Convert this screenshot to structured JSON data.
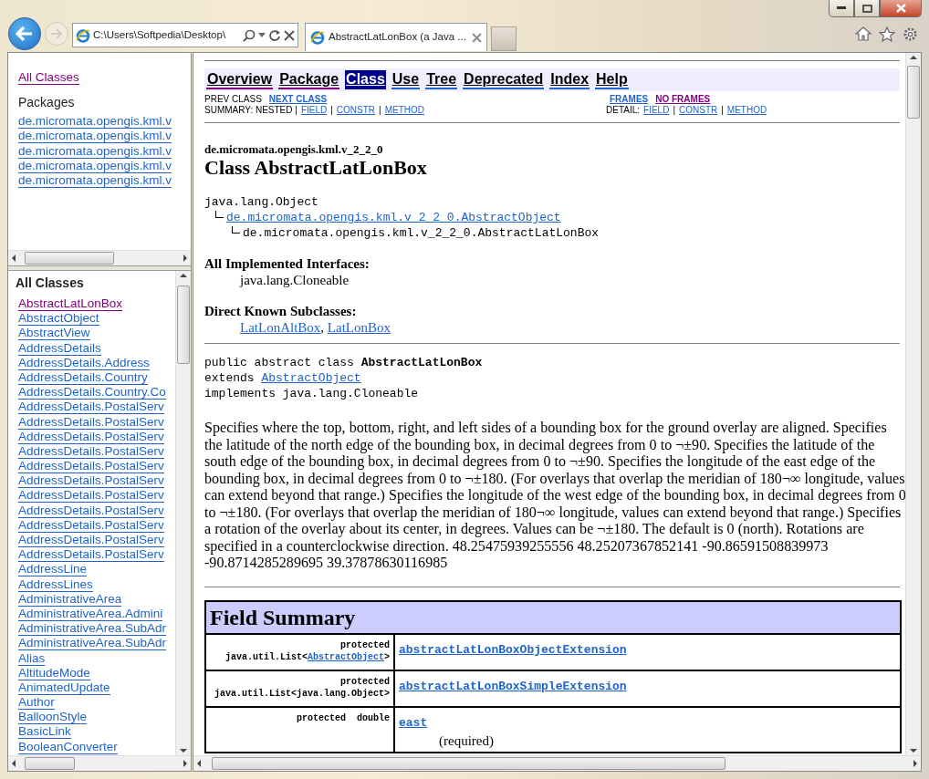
{
  "browser": {
    "address": "C:\\Users\\Softpedia\\Desktop\\",
    "tab_title": "AbstractLatLonBox (a Java ...",
    "forward_disabled": true
  },
  "packages_frame": {
    "all_classes": {
      "text": "All Classes",
      "visited": true
    },
    "heading": "Packages",
    "packages": [
      {
        "text": "de.micromata.opengis.kml.v",
        "visited": false
      },
      {
        "text": "de.micromata.opengis.kml.v",
        "visited": false
      },
      {
        "text": "de.micromata.opengis.kml.v",
        "visited": false
      },
      {
        "text": "de.micromata.opengis.kml.v",
        "visited": false
      },
      {
        "text": "de.micromata.opengis.kml.v",
        "visited": false
      }
    ]
  },
  "classes_frame": {
    "heading": "All Classes",
    "classes": [
      {
        "text": "AbstractLatLonBox",
        "visited": true
      },
      {
        "text": "AbstractObject",
        "visited": false
      },
      {
        "text": "AbstractView",
        "visited": false
      },
      {
        "text": "AddressDetails",
        "visited": false
      },
      {
        "text": "AddressDetails.Address",
        "visited": false
      },
      {
        "text": "AddressDetails.Country",
        "visited": false
      },
      {
        "text": "AddressDetails.Country.Co",
        "visited": false
      },
      {
        "text": "AddressDetails.PostalServ",
        "visited": false
      },
      {
        "text": "AddressDetails.PostalServ",
        "visited": false
      },
      {
        "text": "AddressDetails.PostalServ",
        "visited": false
      },
      {
        "text": "AddressDetails.PostalServ",
        "visited": false
      },
      {
        "text": "AddressDetails.PostalServ",
        "visited": false
      },
      {
        "text": "AddressDetails.PostalServ",
        "visited": false
      },
      {
        "text": "AddressDetails.PostalServ",
        "visited": false
      },
      {
        "text": "AddressDetails.PostalServ",
        "visited": false
      },
      {
        "text": "AddressDetails.PostalServ",
        "visited": false
      },
      {
        "text": "AddressDetails.PostalServ",
        "visited": false
      },
      {
        "text": "AddressDetails.PostalServ",
        "visited": false
      },
      {
        "text": "AddressLine",
        "visited": false
      },
      {
        "text": "AddressLines",
        "visited": false
      },
      {
        "text": "AdministrativeArea",
        "visited": false
      },
      {
        "text": "AdministrativeArea.Admini",
        "visited": false
      },
      {
        "text": "AdministrativeArea.SubAdr",
        "visited": false
      },
      {
        "text": "AdministrativeArea.SubAdr",
        "visited": false
      },
      {
        "text": "Alias",
        "visited": false
      },
      {
        "text": "AltitudeMode",
        "visited": false
      },
      {
        "text": "AnimatedUpdate",
        "visited": false
      },
      {
        "text": "Author",
        "visited": false
      },
      {
        "text": "BalloonStyle",
        "visited": false
      },
      {
        "text": "BasicLink",
        "visited": false
      },
      {
        "text": "BooleanConverter",
        "visited": false
      }
    ]
  },
  "main": {
    "nav": [
      {
        "label": "Overview",
        "selected": false,
        "visited": true
      },
      {
        "label": "Package",
        "selected": false,
        "visited": true
      },
      {
        "label": "Class",
        "selected": true,
        "visited": false
      },
      {
        "label": "Use",
        "selected": false,
        "visited": false
      },
      {
        "label": "Tree",
        "selected": false,
        "visited": false
      },
      {
        "label": "Deprecated",
        "selected": false,
        "visited": false
      },
      {
        "label": "Index",
        "selected": false,
        "visited": false
      },
      {
        "label": "Help",
        "selected": false,
        "visited": false
      }
    ],
    "subnav": [
      {
        "left": [
          {
            "kind": "text",
            "text": "PREV CLASS"
          },
          {
            "kind": "link",
            "text": "NEXT CLASS",
            "visited": false
          }
        ],
        "right": [
          {
            "kind": "link",
            "text": "FRAMES",
            "visited": false
          },
          {
            "kind": "link",
            "text": "NO FRAMES",
            "visited": true
          }
        ]
      },
      {
        "left": [
          {
            "kind": "text",
            "text": "SUMMARY: NESTED |"
          },
          {
            "kind": "link",
            "text": "FIELD",
            "visited": false
          },
          {
            "kind": "text",
            "text": "|"
          },
          {
            "kind": "link",
            "text": "CONSTR",
            "visited": false
          },
          {
            "kind": "text",
            "text": "|"
          },
          {
            "kind": "link",
            "text": "METHOD",
            "visited": false
          }
        ],
        "right": [
          {
            "kind": "text",
            "text": "DETAIL:"
          },
          {
            "kind": "link",
            "text": "FIELD",
            "visited": false
          },
          {
            "kind": "text",
            "text": "|"
          },
          {
            "kind": "link",
            "text": "CONSTR",
            "visited": false
          },
          {
            "kind": "text",
            "text": "|"
          },
          {
            "kind": "link",
            "text": "METHOD",
            "visited": false
          }
        ]
      }
    ],
    "package_label": "de.micromata.opengis.kml.v_2_2_0",
    "class_title": "Class AbstractLatLonBox",
    "hierarchy": {
      "text": "java.lang.Object",
      "link": false,
      "children": [
        {
          "text": "de.micromata.opengis.kml.v_2_2_0.AbstractObject",
          "link": true,
          "children": [
            {
              "text": "de.micromata.opengis.kml.v_2_2_0.AbstractLatLonBox",
              "link": false
            }
          ]
        }
      ]
    },
    "interfaces": {
      "heading": "All Implemented Interfaces:",
      "items": [
        {
          "text": "java.lang.Cloneable",
          "link": false
        }
      ]
    },
    "subclasses": {
      "heading": "Direct Known Subclasses:",
      "separator": ", ",
      "items": [
        {
          "text": "LatLonAltBox",
          "link": true
        },
        {
          "text": "LatLonBox",
          "link": true
        }
      ]
    },
    "declaration": [
      {
        "kind": "text",
        "text": "public abstract class **AbstractLatLonBox**"
      },
      {
        "kind": "extends",
        "prefix": "extends",
        "link": "AbstractObject"
      },
      {
        "kind": "text",
        "text": "implements java.lang.Cloneable"
      }
    ],
    "description": "Specifies where the top, bottom, right, and left sides of a bounding box for the ground overlay are aligned. Specifies the latitude of the north edge of the bounding box, in decimal degrees from 0 to ¬±90. Specifies the latitude of the south edge of the bounding box, in decimal degrees from 0 to ¬±90. Specifies the longitude of the east edge of the bounding box, in decimal degrees from 0 to ¬±180. (For overlays that overlap the meridian of 180¬∞ longitude, values can extend beyond that range.) Specifies the longitude of the west edge of the bounding box, in decimal degrees from 0 to ¬±180. (For overlays that overlap the meridian of 180¬∞ longitude, values can extend beyond that range.) Specifies a rotation of the overlay about its center, in degrees. Values can be ¬±180. The default is 0 (north). Rotations are specified in a counterclockwise direction. 48.25475939255556 48.25207367852141 -90.86591508839973 -90.8714285289695 39.37878630116985",
    "field_summary": {
      "title": "Field Summary",
      "rows": [
        {
          "modifier": [
            {
              "text": "protected"
            },
            {
              "text": "java.util.List<",
              "link": "AbstractObject",
              "suffix": ">"
            }
          ],
          "name": "abstractLatLonBoxObjectExtension"
        },
        {
          "modifier": [
            {
              "text": "protected"
            },
            {
              "text": "java.util.List<java.lang.Object>"
            }
          ],
          "name": "abstractLatLonBoxSimpleExtension"
        },
        {
          "modifier": [
            {
              "text": "protected  double"
            }
          ],
          "name": "east",
          "description": "(required)"
        }
      ]
    }
  }
}
